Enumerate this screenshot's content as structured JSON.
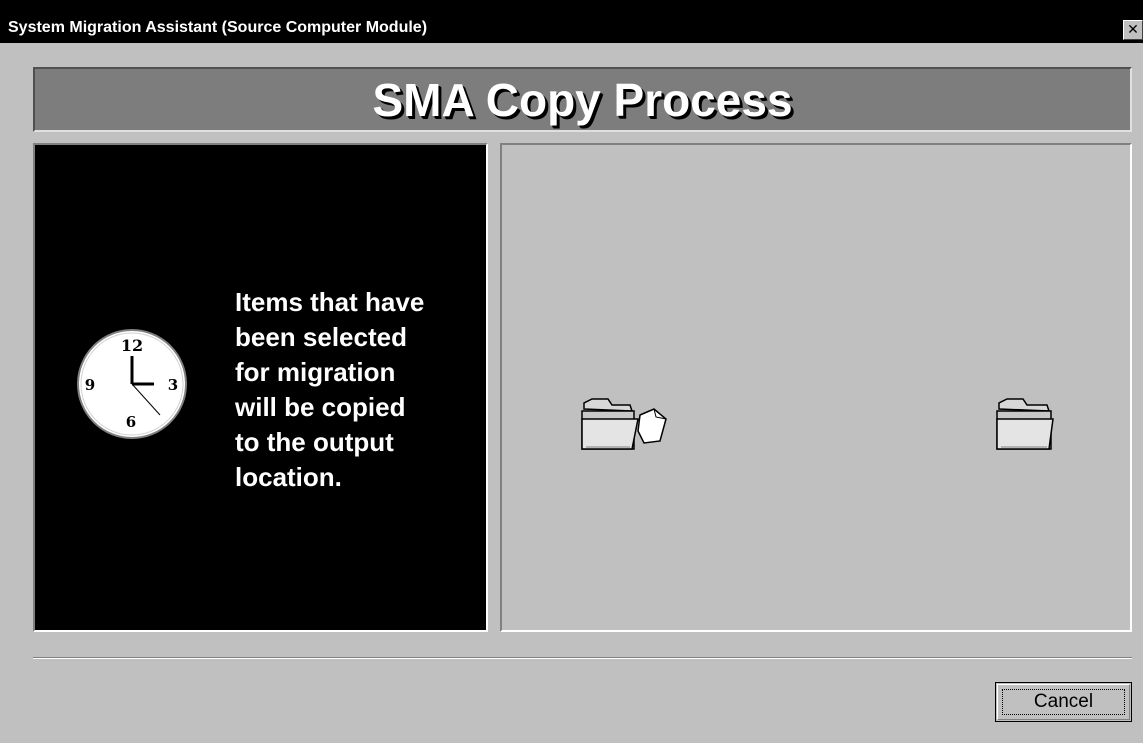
{
  "window": {
    "title": "System Migration Assistant (Source Computer Module)",
    "close_glyph": "✕"
  },
  "header": {
    "title": "SMA Copy Process"
  },
  "clock": {
    "numbers": {
      "twelve": "12",
      "three": "3",
      "six": "6",
      "nine": "9"
    },
    "icon": "clock-icon"
  },
  "info": {
    "lines": [
      "Items that have",
      "been selected",
      "for migration",
      "will be copied",
      "to the output",
      "location."
    ]
  },
  "animation": {
    "source_icon": "folder-with-document-icon",
    "destination_icon": "folder-icon"
  },
  "footer": {
    "cancel_label": "Cancel"
  },
  "colors": {
    "title_bar": "#000000",
    "window_bg": "#c0c0c0",
    "header_band": "#7d7d7d",
    "left_panel_bg": "#000000"
  }
}
